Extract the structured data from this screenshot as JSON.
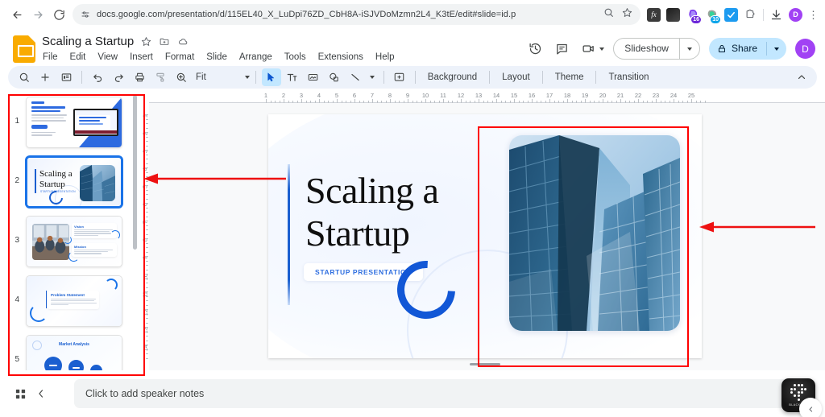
{
  "browser": {
    "back_icon": "back-arrow-icon",
    "forward_icon": "forward-arrow-icon",
    "reload_icon": "reload-icon",
    "url": "docs.google.com/presentation/d/115EL40_X_LuDpi76ZD_CbH8A-iSJVDoMzmn2L4_K3tE/edit#slide=id.p",
    "site_icon": "site-settings-icon",
    "zoom_icon": "page-zoom-icon",
    "bookmark_icon": "star-icon",
    "extensions": [
      {
        "name": "fx-extension-icon",
        "glyph": "fx",
        "badge": ""
      },
      {
        "name": "dark-extension-icon",
        "glyph": "",
        "badge": ""
      },
      {
        "name": "purple-extension-icon",
        "glyph": "",
        "badge": "16"
      },
      {
        "name": "green-extension-icon",
        "glyph": "",
        "badge": "10"
      },
      {
        "name": "grammarly-extension-icon",
        "glyph": "✔",
        "badge": ""
      },
      {
        "name": "puzzle-extensions-icon",
        "glyph": "",
        "badge": ""
      }
    ],
    "download_icon": "download-icon",
    "profile_initial": "D",
    "menu_icon": "chrome-menu-icon"
  },
  "header": {
    "app_icon": "google-slides-logo",
    "doc_title": "Scaling a Startup",
    "title_icons": [
      "star-icon",
      "move-to-folder-icon",
      "cloud-saved-icon"
    ],
    "menus": [
      "File",
      "Edit",
      "View",
      "Insert",
      "Format",
      "Slide",
      "Arrange",
      "Tools",
      "Extensions",
      "Help"
    ],
    "right_icons": [
      "version-history-icon",
      "comment-history-icon",
      "meet-camera-icon"
    ],
    "slideshow_label": "Slideshow",
    "share_label": "Share",
    "share_lock_icon": "lock-icon",
    "profile_initial": "D"
  },
  "toolbar": {
    "icons": [
      "search-icon",
      "new-slide-icon",
      "layout-icon",
      "undo-icon",
      "redo-icon",
      "print-icon",
      "paint-format-icon",
      "zoom-icon"
    ],
    "zoom_label": "Fit",
    "tool_icons": [
      "select-cursor-icon",
      "text-box-icon",
      "insert-image-icon",
      "shape-icon",
      "line-icon"
    ],
    "comment_icon": "add-comment-icon",
    "text_buttons": [
      "Background",
      "Layout",
      "Theme",
      "Transition"
    ],
    "collapse_icon": "collapse-toolbar-icon"
  },
  "rulers": {
    "horizontal_ticks": [
      1,
      2,
      3,
      4,
      5,
      6,
      7,
      8,
      9,
      10,
      11,
      12,
      13,
      14,
      15,
      16,
      17,
      18,
      19,
      20,
      21,
      22,
      23,
      24,
      25
    ],
    "vertical_ticks": [
      1,
      2,
      3,
      4,
      5,
      6,
      7,
      8,
      9,
      10,
      11,
      12,
      13,
      14
    ]
  },
  "slide_panel": {
    "slides": [
      {
        "number": "1",
        "title": "This template was created by SlidesAI",
        "selected": false
      },
      {
        "number": "2",
        "title": "Scaling a Startup",
        "selected": true
      },
      {
        "number": "3",
        "title": "Vision",
        "subtitle": "Mission",
        "selected": false
      },
      {
        "number": "4",
        "title": "Problem Statement",
        "selected": false
      },
      {
        "number": "5",
        "title": "Market Analysis",
        "selected": false
      }
    ],
    "thumb2": {
      "title_line1": "Scaling a",
      "title_line2": "Startup",
      "subtitle": "STARTUP PRESENTATION"
    },
    "thumb3": {
      "heading1": "Vision",
      "heading2": "Mission"
    },
    "thumb4": {
      "heading": "Problem Statement"
    },
    "thumb5": {
      "heading": "Market Analysis"
    }
  },
  "slide": {
    "title_line1": "Scaling a",
    "title_line2": "Startup",
    "badge": "STARTUP PRESENTATION",
    "image_alt": "skyscrapers-photo",
    "accent_color": "#1257d6"
  },
  "notes": {
    "grid_icon": "filmstrip-view-icon",
    "collapse_icon": "hide-filmstrip-icon",
    "placeholder": "Click to add speaker notes"
  },
  "blackbox": {
    "label": "BLACKBOX",
    "side_icon": "chevron-left-icon"
  },
  "annotations": {
    "panel_box_color": "#ff0000",
    "photo_box_color": "#ff0000",
    "arrow_color": "#ee1111",
    "arrow_left_label": "arrow-to-slide-panel",
    "arrow_right_label": "arrow-to-image"
  }
}
